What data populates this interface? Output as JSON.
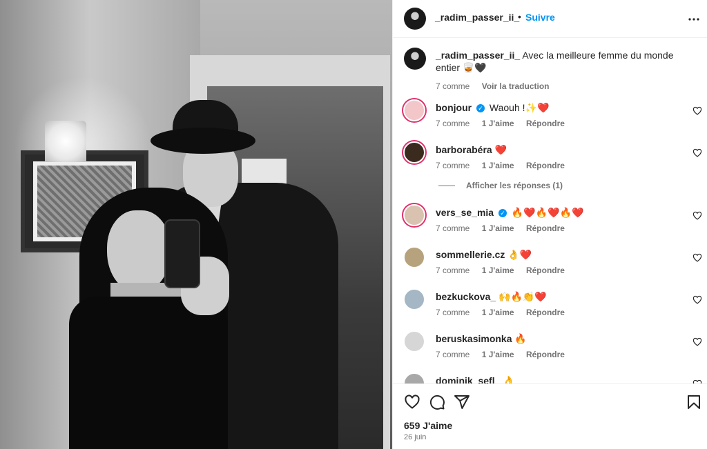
{
  "post": {
    "username": "_radim_passer_ii_",
    "follow_label": "Suivre",
    "dot": "•"
  },
  "caption": {
    "username": "_radim_passer_ii_",
    "text": "Avec la meilleure femme du monde entier 🥃🖤",
    "time": "7 comme",
    "see_translation": "Voir la traduction"
  },
  "comments": [
    {
      "user": "bonjour",
      "verified": true,
      "text": "Waouh !✨❤️",
      "time": "7 comme",
      "likes": "1 J'aime",
      "reply": "Répondre",
      "avatar_color": "#f3c6c9"
    },
    {
      "user": "barborabéra",
      "verified": false,
      "text": "❤️",
      "time": "7 comme",
      "likes": "1 J'aime",
      "reply": "Répondre",
      "avatar_color": "#3b2b1f"
    },
    {
      "user": "vers_se_mia",
      "verified": true,
      "text": "🔥❤️🔥❤️🔥❤️",
      "time": "7 comme",
      "likes": "1 J'aime",
      "reply": "Répondre",
      "avatar_color": "#d9c3b0"
    },
    {
      "user": "sommellerie.cz",
      "verified": false,
      "text": "👌❤️",
      "time": "7 comme",
      "likes": "1 J'aime",
      "reply": "Répondre",
      "avatar_color": "#b6a27d"
    },
    {
      "user": "bezkuckova_",
      "verified": false,
      "text": "🙌🔥👏❤️",
      "time": "7 comme",
      "likes": "1 J'aime",
      "reply": "Répondre",
      "avatar_color": "#a5b6c4"
    },
    {
      "user": "beruskasimonka",
      "verified": false,
      "text": "🔥",
      "time": "7 comme",
      "likes": "1 J'aime",
      "reply": "Répondre",
      "avatar_color": "#d6d6d6"
    },
    {
      "user": "dominik_sefl_",
      "verified": false,
      "text": "👌",
      "time": "",
      "likes": "",
      "reply": "",
      "avatar_color": "#a8a8a8"
    }
  ],
  "show_replies": "Afficher les réponses (1)",
  "footer": {
    "likes": "659 J'aime",
    "date": "26 juin"
  },
  "icons": {
    "more": "more-horizontal-icon",
    "like": "heart-outline-icon",
    "comment": "comment-bubble-icon",
    "share": "send-paper-plane-icon",
    "save": "bookmark-icon"
  },
  "colors": {
    "follow": "#0095f6",
    "verified": "#0095f6",
    "meta": "#737373",
    "text": "#262626"
  }
}
